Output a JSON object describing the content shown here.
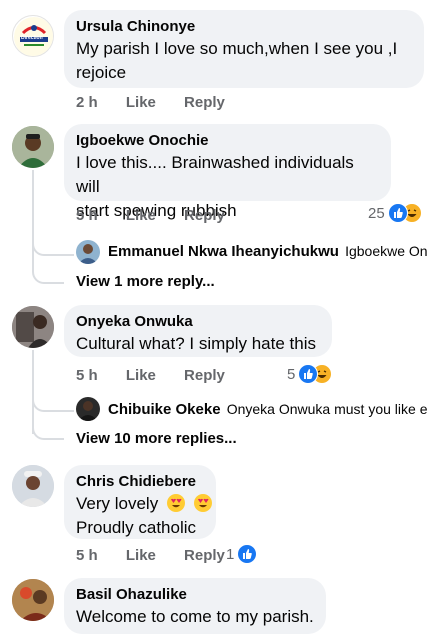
{
  "comments": [
    {
      "author": "Ursula Chinonye",
      "text_line1": "My parish I love so much,when I see you ,I",
      "text_line2": "rejoice",
      "time": "2 h",
      "like": "Like",
      "reply": "Reply",
      "avatar_logo_text": "Direction"
    },
    {
      "author": "Igboekwe Onochie",
      "text_line1": "I love this.... Brainwashed individuals will",
      "text_line2": "start spewing rubbish",
      "time": "5 h",
      "like": "Like",
      "reply": "Reply",
      "reaction_count": "25",
      "reply_preview": {
        "author": "Emmanuel Nkwa Iheanyichukwu",
        "text": "Igboekwe On..."
      },
      "more_replies": "View 1 more reply..."
    },
    {
      "author": "Onyeka Onwuka",
      "text_line1": "Cultural what?  I simply hate this",
      "time": "5 h",
      "like": "Like",
      "reply": "Reply",
      "reaction_count": "5",
      "reply_preview": {
        "author": "Chibuike Okeke",
        "text": "Onyeka Onwuka must you like e..."
      },
      "more_replies": "View 10 more replies..."
    },
    {
      "author": "Chris Chidiebere",
      "text_line1": "Very lovely",
      "text_line2": "Proudly catholic",
      "time": "5 h",
      "like": "Like",
      "reply": "Reply",
      "reaction_count": "1"
    },
    {
      "author": "Basil Ohazulike",
      "text_line1": "Welcome to come to my parish."
    }
  ],
  "colors": {
    "like_blue": "#1877f2",
    "haha_yellow": "#f7b125",
    "love_red": "#f33e58",
    "bubble": "#f0f2f5",
    "meta": "#65676b"
  }
}
